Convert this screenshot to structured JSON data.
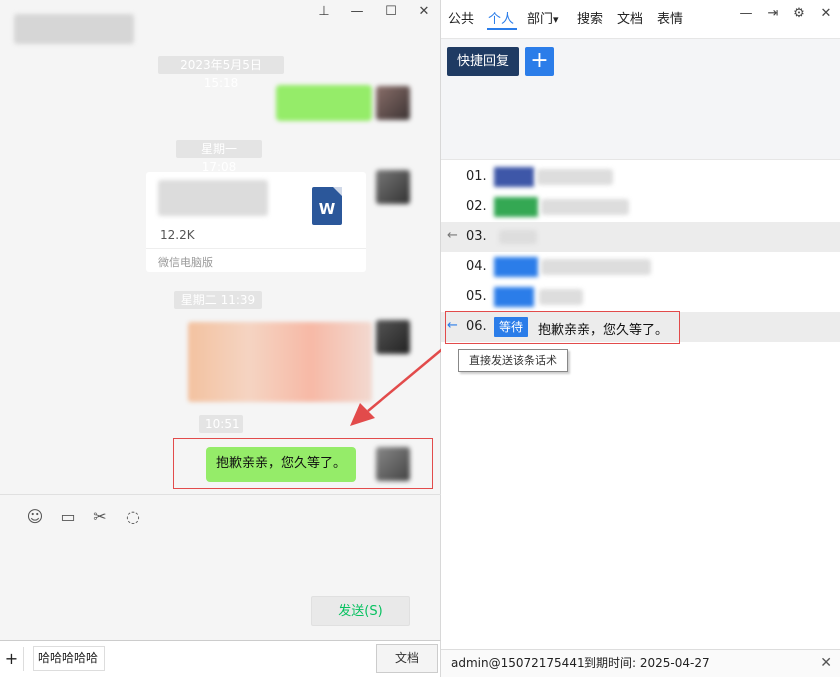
{
  "chat": {
    "timestamps": [
      "2023年5月5日 15:18",
      "星期一 17:08",
      "星期二 11:39",
      "10:51"
    ],
    "file": {
      "size": "12.2K",
      "source": "微信电脑版",
      "icon_letter": "W"
    },
    "last_message": "抱歉亲亲，您久等了。",
    "window_controls": [
      "pin-icon",
      "minimize-icon",
      "maximize-icon",
      "close-icon"
    ],
    "tools": [
      "emoji-icon",
      "folder-icon",
      "scissors-icon",
      "chat-bubble-icon"
    ],
    "send_label": "发送(S)"
  },
  "bottom": {
    "plus": "+",
    "quick_input": "哈哈哈哈哈",
    "doc_button": "文档"
  },
  "panel": {
    "tabs": [
      "公共",
      "个人",
      "部门",
      "搜索",
      "文档",
      "表情"
    ],
    "active_tab": "个人",
    "dept_caret": "▾",
    "quick_reply_label": "快捷回复",
    "add_label": "+",
    "rows": [
      {
        "num": "01.",
        "tag_color": "#3e57a8"
      },
      {
        "num": "02.",
        "tag_color": "#34a853"
      },
      {
        "num": "03.",
        "arrow": "←"
      },
      {
        "num": "04.",
        "tag_color": "#2b7de9"
      },
      {
        "num": "05.",
        "tag_color": "#2b7de9"
      },
      {
        "num": "06.",
        "arrow": "←",
        "tag": "等待",
        "tag_color": "#2b7de9",
        "text": "抱歉亲亲，您久等了。"
      }
    ],
    "tooltip": "直接发送该条话术",
    "footer": {
      "user": "admin@15072175441",
      "expiry_label": "到期时间:",
      "expiry_date": "2025-04-27"
    }
  },
  "colors": {
    "accent": "#2b7de9",
    "dark_button": "#1f3b63",
    "chat_green": "#95ec69",
    "send_text": "#07c160",
    "annotation_red": "#e24b4b"
  }
}
